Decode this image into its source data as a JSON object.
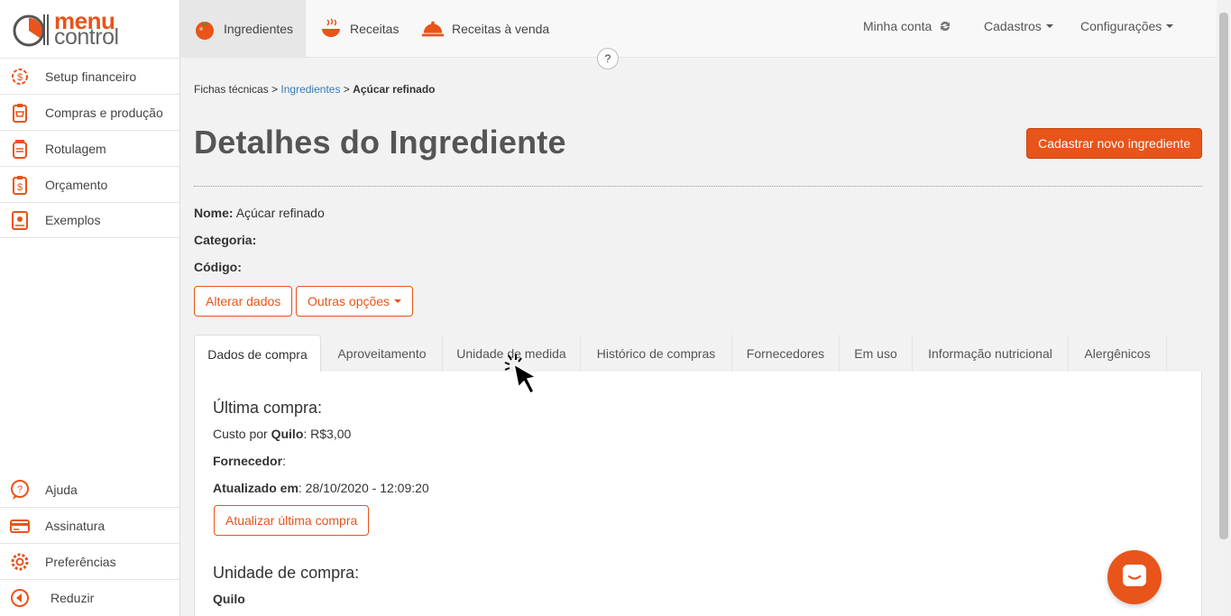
{
  "brand": {
    "line1": "menu",
    "line2": "control"
  },
  "sidebar": {
    "items": [
      {
        "label": "Setup financeiro",
        "icon": "dollar-gear-icon"
      },
      {
        "label": "Compras e produção",
        "icon": "shopping-clipboard-icon"
      },
      {
        "label": "Rotulagem",
        "icon": "label-jar-icon"
      },
      {
        "label": "Orçamento",
        "icon": "budget-clipboard-icon"
      },
      {
        "label": "Exemplos",
        "icon": "book-icon"
      }
    ],
    "bottom": [
      {
        "label": "Ajuda",
        "icon": "help-bubble-icon"
      },
      {
        "label": "Assinatura",
        "icon": "credit-card-icon"
      },
      {
        "label": "Preferências",
        "icon": "gear-icon"
      },
      {
        "label": "Reduzir",
        "icon": "collapse-left-icon"
      }
    ]
  },
  "topnav": {
    "tabs": [
      {
        "label": "Ingredientes",
        "icon": "tomato-icon",
        "active": true
      },
      {
        "label": "Receitas",
        "icon": "cooking-pot-icon"
      },
      {
        "label": "Receitas à venda",
        "icon": "cloche-icon"
      }
    ],
    "account": "Minha conta",
    "cadastros": "Cadastros",
    "configuracoes": "Configurações",
    "help": "?"
  },
  "breadcrumb": {
    "root": "Fichas técnicas",
    "sep": ">",
    "link": "Ingredientes",
    "current": "Açúcar refinado"
  },
  "page": {
    "title": "Detalhes do Ingrediente",
    "new_button": "Cadastrar novo ingrediente"
  },
  "details": {
    "name_label": "Nome:",
    "name_value": "Açúcar refinado",
    "category_label": "Categoria:",
    "code_label": "Código:",
    "edit_button": "Alterar dados",
    "options_button": "Outras opções"
  },
  "tabs": [
    "Dados de compra",
    "Aproveitamento",
    "Unidade de medida",
    "Histórico de compras",
    "Fornecedores",
    "Em uso",
    "Informação nutricional",
    "Alergênicos"
  ],
  "panel": {
    "last_purchase_title": "Última compra:",
    "cost_prefix": "Custo por",
    "cost_unit": "Quilo",
    "cost_value": ": R$3,00",
    "supplier_label": "Fornecedor",
    "supplier_suffix": ":",
    "updated_label": "Atualizado em",
    "updated_value": ": 28/10/2020 - 12:09:20",
    "update_button": "Atualizar última compra",
    "unit_title": "Unidade de compra:",
    "unit_value": "Quilo"
  },
  "colors": {
    "accent": "#e8541a",
    "link": "#337ab7"
  }
}
